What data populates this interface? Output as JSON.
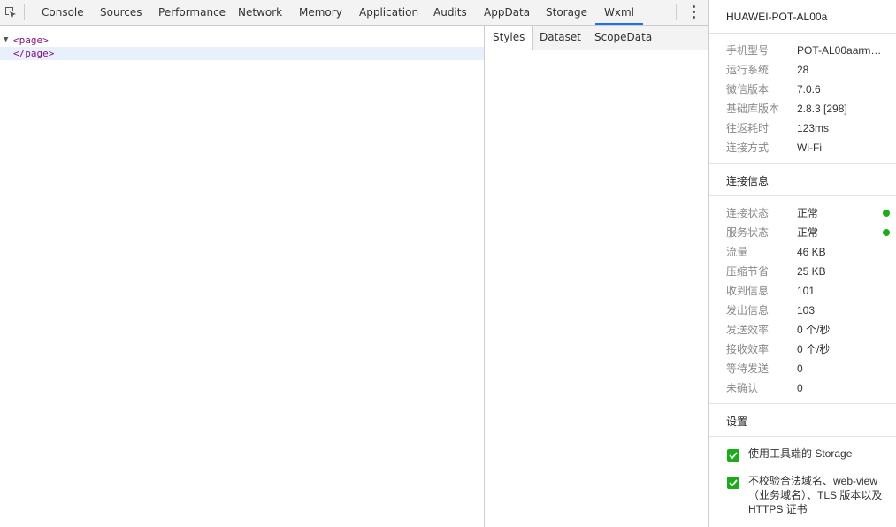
{
  "toolbar": {
    "tabs": [
      "Console",
      "Sources",
      "Performance",
      "Network",
      "Memory",
      "Application",
      "Audits",
      "AppData",
      "Storage",
      "Wxml"
    ],
    "active_tab": "Wxml"
  },
  "elements": {
    "rows": [
      {
        "text": "<page>"
      },
      {
        "text": "</page>"
      }
    ]
  },
  "styles_pane": {
    "tabs": [
      "Styles",
      "Dataset",
      "ScopeData"
    ],
    "active_tab": "Styles"
  },
  "device": {
    "name": "HUAWEI-POT-AL00a",
    "info": [
      {
        "label": "手机型号",
        "value": "POT-AL00aarme..."
      },
      {
        "label": "运行系统",
        "value": "28"
      },
      {
        "label": "微信版本",
        "value": "7.0.6"
      },
      {
        "label": "基础库版本",
        "value": "2.8.3 [298]"
      },
      {
        "label": "往返耗时",
        "value": "123ms"
      },
      {
        "label": "连接方式",
        "value": "Wi-Fi"
      }
    ]
  },
  "connection": {
    "title": "连接信息",
    "items": [
      {
        "label": "连接状态",
        "value": "正常"
      },
      {
        "label": "服务状态",
        "value": "正常"
      },
      {
        "label": "流量",
        "value": "46 KB"
      },
      {
        "label": "压缩节省",
        "value": "25 KB"
      },
      {
        "label": "收到信息",
        "value": "101"
      },
      {
        "label": "发出信息",
        "value": "103"
      },
      {
        "label": "发送效率",
        "value": "0 个/秒"
      },
      {
        "label": "接收效率",
        "value": "0 个/秒"
      },
      {
        "label": "等待发送",
        "value": "0"
      },
      {
        "label": "未确认",
        "value": "0"
      }
    ],
    "status_color": "#1aad19"
  },
  "settings": {
    "title": "设置",
    "options": [
      {
        "label": "使用工具端的 Storage",
        "checked": true
      },
      {
        "label": "不校验合法域名、web-view（业务域名）、TLS 版本以及 HTTPS 证书",
        "checked": true
      }
    ]
  },
  "colors": {
    "accent": "#1a73e8",
    "check": "#1aad19",
    "tag": "#881280"
  }
}
